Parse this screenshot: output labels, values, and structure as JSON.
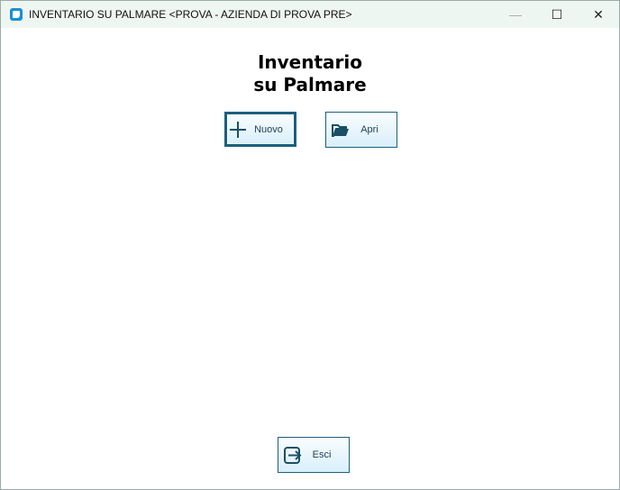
{
  "window": {
    "title": "INVENTARIO SU PALMARE <PROVA - AZIENDA DI PROVA PRE>",
    "minimize": "—",
    "maximize": "☐",
    "close": "✕"
  },
  "heading": {
    "line1": "Inventario",
    "line2": "su Palmare"
  },
  "buttons": {
    "nuovo": "Nuovo",
    "apri": "Apri",
    "esci": "Esci"
  }
}
